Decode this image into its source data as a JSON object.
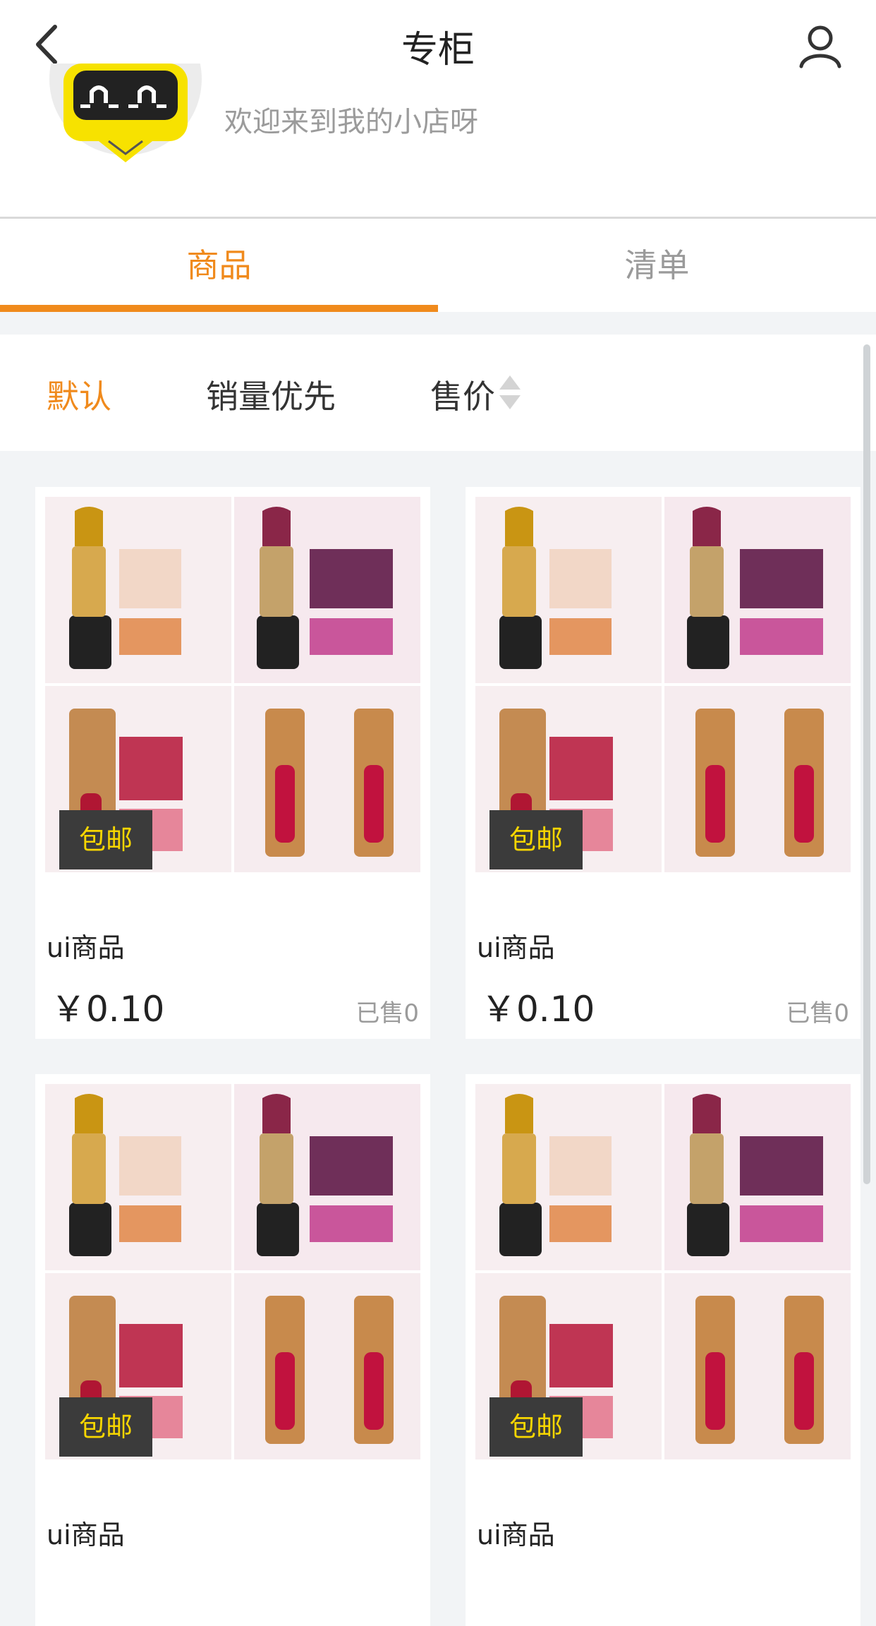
{
  "header": {
    "title": "专柜",
    "back_icon": "chevron-left-icon",
    "user_icon": "user-icon"
  },
  "shop": {
    "welcome": "欢迎来到我的小店呀",
    "avatar": "robot-mascot-avatar"
  },
  "tabs": [
    {
      "label": "商品",
      "active": true
    },
    {
      "label": "清单",
      "active": false
    }
  ],
  "sort": {
    "default_label": "默认",
    "sales_label": "销量优先",
    "price_label": "售价",
    "sort_icon": "sort-arrows-icon"
  },
  "products": [
    {
      "name": "ui商品",
      "price": "￥0.10",
      "sold": "已售0",
      "badge": "包邮"
    },
    {
      "name": "ui商品",
      "price": "￥0.10",
      "sold": "已售0",
      "badge": "包邮"
    },
    {
      "name": "ui商品",
      "price": "",
      "sold": "",
      "badge": "包邮"
    },
    {
      "name": "ui商品",
      "price": "",
      "sold": "",
      "badge": "包邮"
    }
  ],
  "colors": {
    "accent": "#f08a1c",
    "badge_bg": "#3b3b3b",
    "badge_text": "#f7d600",
    "muted_text": "#9b9b9b"
  }
}
